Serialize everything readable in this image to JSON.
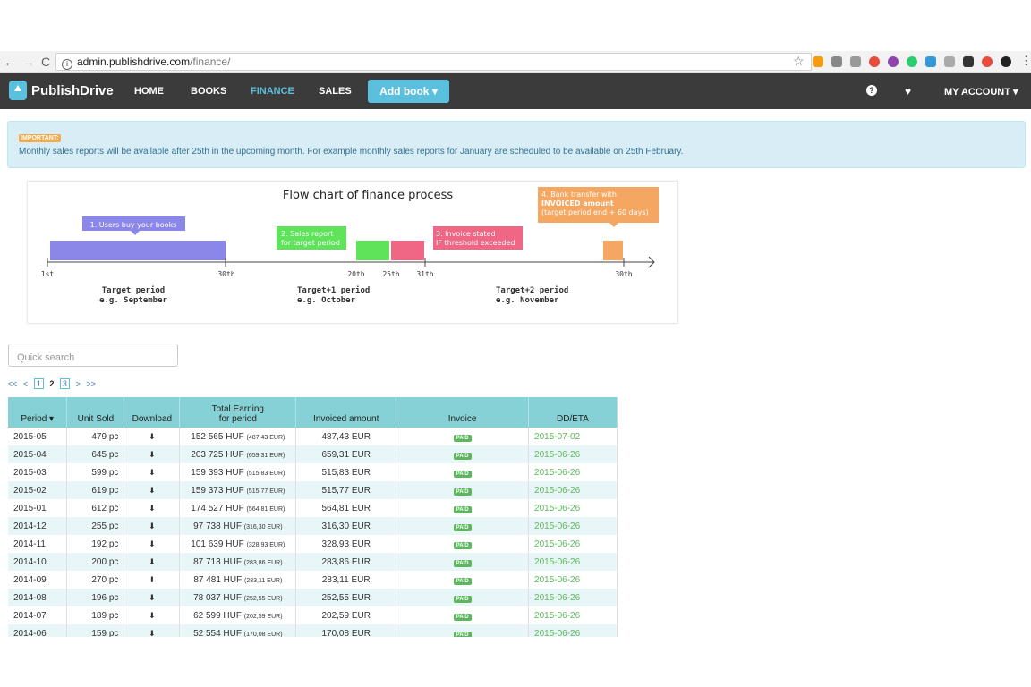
{
  "browser": {
    "url_domain": "admin.publishdrive.com",
    "url_path": "/finance/"
  },
  "nav": {
    "brand": "PublishDrive",
    "items": [
      "HOME",
      "BOOKS",
      "FINANCE",
      "SALES"
    ],
    "add_book": "Add book ▾",
    "my_account": "MY ACCOUNT ▾"
  },
  "alert": {
    "badge": "IMPORTANT:",
    "text": "Monthly sales reports will be available after 25th in the upcoming month. For example monthly sales reports for January are scheduled to be available on 25th February."
  },
  "flow": {
    "title": "Flow chart of finance process",
    "step1": "1. Users buy your books",
    "step2": [
      "2. Sales report",
      "for target period"
    ],
    "step3": [
      "3. Invoice stated",
      "IF threshold exceeded"
    ],
    "step4": [
      "4. Bank transfer with",
      "INVOICED amount",
      "(target period end + 60 days)"
    ],
    "ticks": [
      "1st",
      "30th",
      "20th",
      "25th",
      "31th",
      "30th"
    ],
    "periods": [
      [
        "Target period",
        "e.g. September"
      ],
      [
        "Target+1 period",
        "e.g. October"
      ],
      [
        "Target+2 period",
        "e.g. November"
      ]
    ],
    "colors": {
      "step1": "#8b87e8",
      "step2": "#5ee35b",
      "step3": "#ef6784",
      "step4": "#f5a660"
    }
  },
  "search": {
    "placeholder": "Quick search"
  },
  "pager": {
    "first": "<<",
    "prev": "<",
    "pages": [
      "1",
      "2",
      "3"
    ],
    "current": "2",
    "next": ">",
    "last": ">>"
  },
  "table": {
    "headers": [
      "Period ▾",
      "Unit Sold",
      "Download",
      "Total Earning\nfor period",
      "Invoiced amount",
      "Invoice",
      "DD/ETA"
    ],
    "rows": [
      {
        "period": "2015-05",
        "units": "479 pc",
        "huf": "152 565 HUF",
        "eur": "(487,43 EUR)",
        "invoiced": "487,43 EUR",
        "status": "PAID",
        "eta": "2015-07-02"
      },
      {
        "period": "2015-04",
        "units": "645 pc",
        "huf": "203 725 HUF",
        "eur": "(659,31 EUR)",
        "invoiced": "659,31 EUR",
        "status": "PAID",
        "eta": "2015-06-26"
      },
      {
        "period": "2015-03",
        "units": "599 pc",
        "huf": "159 393 HUF",
        "eur": "(515,83 EUR)",
        "invoiced": "515,83 EUR",
        "status": "PAID",
        "eta": "2015-06-26"
      },
      {
        "period": "2015-02",
        "units": "619 pc",
        "huf": "159 373 HUF",
        "eur": "(515,77 EUR)",
        "invoiced": "515,77 EUR",
        "status": "PAID",
        "eta": "2015-06-26"
      },
      {
        "period": "2015-01",
        "units": "612 pc",
        "huf": "174 527 HUF",
        "eur": "(564,81 EUR)",
        "invoiced": "564,81 EUR",
        "status": "PAID",
        "eta": "2015-06-26"
      },
      {
        "period": "2014-12",
        "units": "255 pc",
        "huf": "97 738 HUF",
        "eur": "(316,30 EUR)",
        "invoiced": "316,30 EUR",
        "status": "PAID",
        "eta": "2015-06-26"
      },
      {
        "period": "2014-11",
        "units": "192 pc",
        "huf": "101 639 HUF",
        "eur": "(328,93 EUR)",
        "invoiced": "328,93 EUR",
        "status": "PAID",
        "eta": "2015-06-26"
      },
      {
        "period": "2014-10",
        "units": "200 pc",
        "huf": "87 713 HUF",
        "eur": "(283,86 EUR)",
        "invoiced": "283,86 EUR",
        "status": "PAID",
        "eta": "2015-06-26"
      },
      {
        "period": "2014-09",
        "units": "270 pc",
        "huf": "87 481 HUF",
        "eur": "(283,11 EUR)",
        "invoiced": "283,11 EUR",
        "status": "PAID",
        "eta": "2015-06-26"
      },
      {
        "period": "2014-08",
        "units": "196 pc",
        "huf": "78 037 HUF",
        "eur": "(252,55 EUR)",
        "invoiced": "252,55 EUR",
        "status": "PAID",
        "eta": "2015-06-26"
      },
      {
        "period": "2014-07",
        "units": "189 pc",
        "huf": "62 599 HUF",
        "eur": "(202,59 EUR)",
        "invoiced": "202,59 EUR",
        "status": "PAID",
        "eta": "2015-06-26"
      },
      {
        "period": "2014-06",
        "units": "159 pc",
        "huf": "52 554 HUF",
        "eur": "(170,08 EUR)",
        "invoiced": "170,08 EUR",
        "status": "PAID",
        "eta": "2015-06-26"
      }
    ]
  }
}
